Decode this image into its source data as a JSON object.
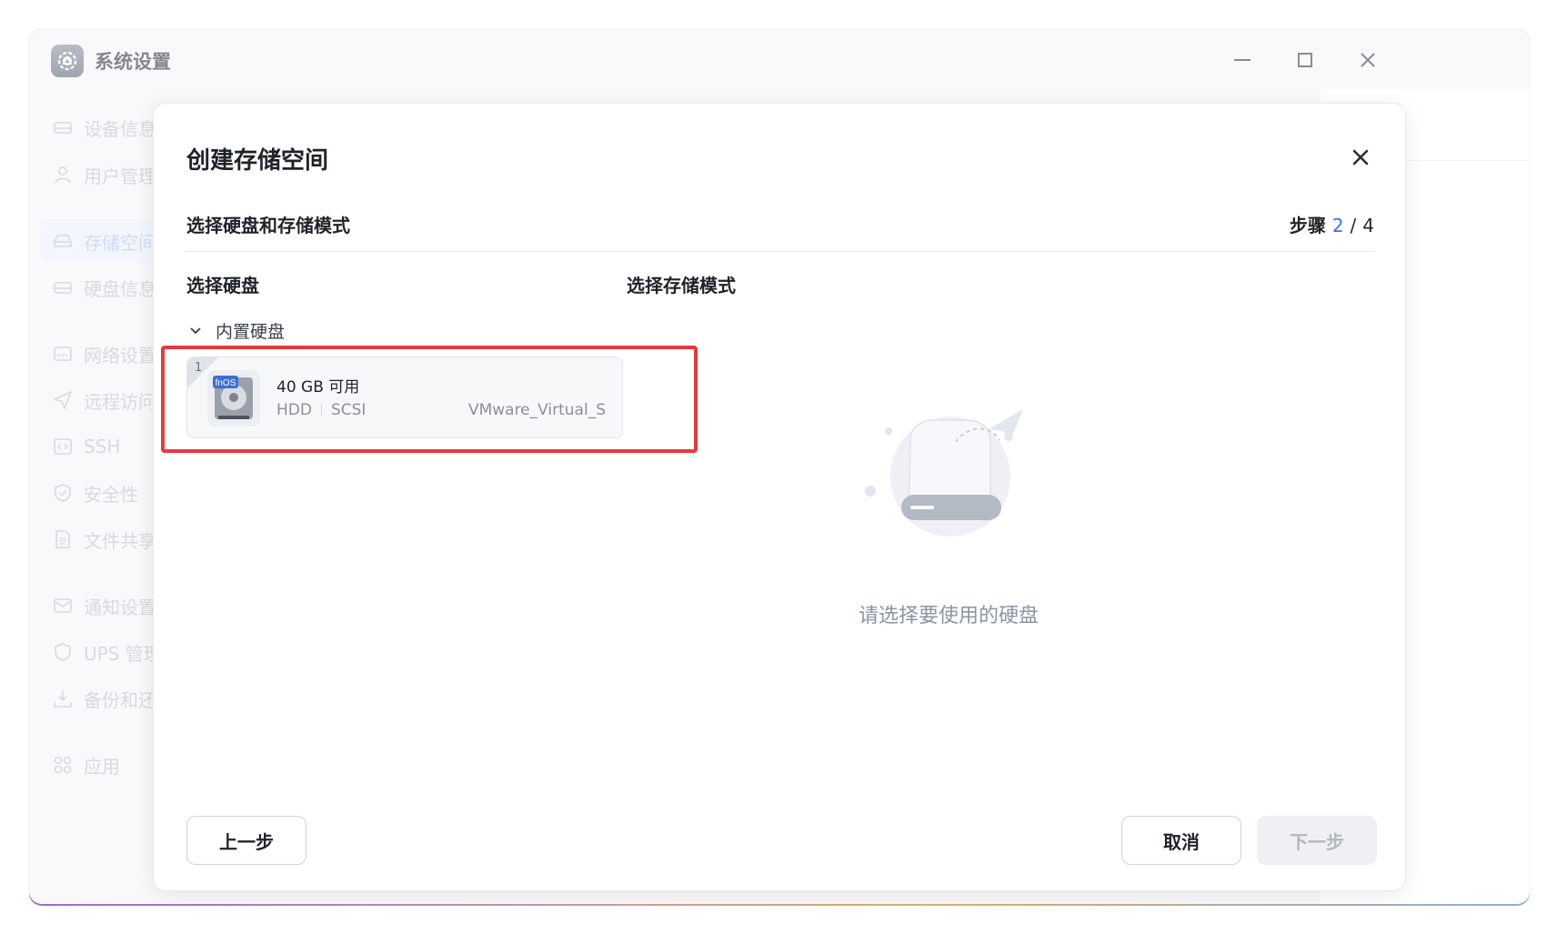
{
  "window": {
    "title": "系统设置"
  },
  "sidebar": {
    "items": [
      {
        "label": "设备信息",
        "icon": "device-icon"
      },
      {
        "label": "用户管理",
        "icon": "user-icon"
      },
      {
        "label": "存储空间",
        "icon": "storage-icon",
        "active": true
      },
      {
        "label": "硬盘信息",
        "icon": "disk-icon"
      },
      {
        "label": "网络设置",
        "icon": "network-icon"
      },
      {
        "label": "远程访问",
        "icon": "send-icon"
      },
      {
        "label": "SSH",
        "icon": "code-icon"
      },
      {
        "label": "安全性",
        "icon": "shield-check-icon"
      },
      {
        "label": "文件共享",
        "icon": "file-icon"
      },
      {
        "label": "通知设置",
        "icon": "mail-icon"
      },
      {
        "label": "UPS 管理",
        "icon": "shield-icon"
      },
      {
        "label": "备份和还原",
        "icon": "download-icon"
      },
      {
        "label": "应用",
        "icon": "apps-icon"
      }
    ]
  },
  "dialog": {
    "title": "创建存储空间",
    "subtitle": "选择硬盘和存储模式",
    "steps_label": "步骤",
    "step_current": "2",
    "step_separator": "/",
    "step_total": "4",
    "disk_column_title": "选择硬盘",
    "mode_column_title": "选择存储模式",
    "group_label": "内置硬盘",
    "disk": {
      "slot": "1",
      "capacity": "40 GB 可用",
      "type": "HDD",
      "interface": "SCSI",
      "model": "VMware_Virtual_S",
      "badge": "fnOS"
    },
    "empty_text": "请选择要使用的硬盘",
    "buttons": {
      "prev": "上一步",
      "cancel": "取消",
      "next": "下一步"
    }
  },
  "colors": {
    "accent": "#3b72e8",
    "highlight": "#e8383d"
  }
}
